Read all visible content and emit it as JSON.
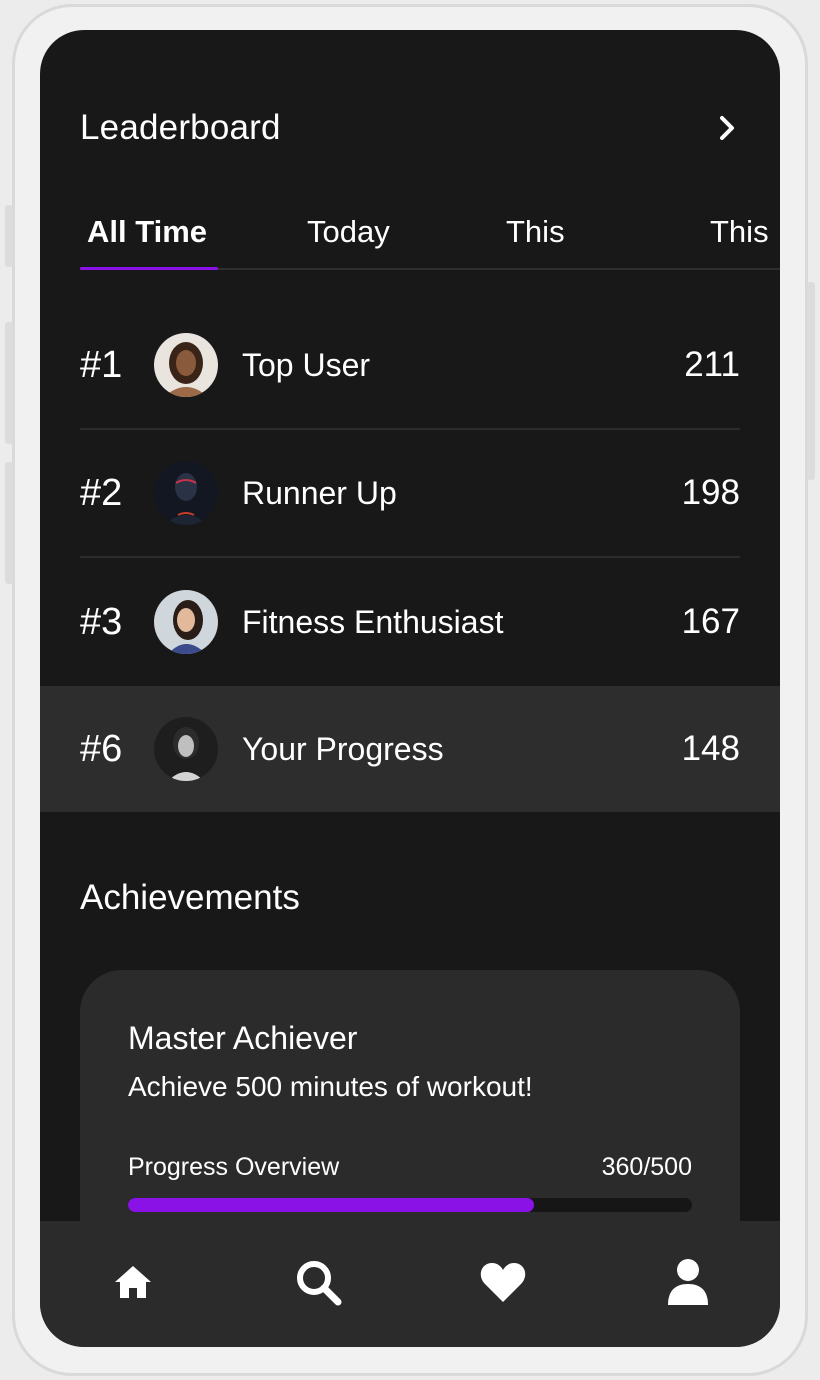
{
  "header": {
    "title": "Leaderboard",
    "chevron_icon": "chevron-right-icon"
  },
  "tabs": [
    {
      "label": "All Time",
      "active": true
    },
    {
      "label": "Today",
      "active": false
    },
    {
      "label": "This",
      "active": false
    },
    {
      "label": "This",
      "active": false
    }
  ],
  "leaderboard": [
    {
      "rank": "#1",
      "name": "Top User",
      "score": "211"
    },
    {
      "rank": "#2",
      "name": "Runner Up",
      "score": "198"
    },
    {
      "rank": "#3",
      "name": "Fitness Enthusiast",
      "score": "167"
    }
  ],
  "current_user": {
    "rank": "#6",
    "name": "Your Progress",
    "score": "148"
  },
  "achievements": {
    "section_title": "Achievements",
    "card": {
      "title": "Master Achiever",
      "description": "Achieve 500 minutes of workout!",
      "progress_label": "Progress Overview",
      "progress_text": "360/500",
      "progress_fraction": 0.72
    }
  },
  "bottom_nav": [
    {
      "icon": "home-icon"
    },
    {
      "icon": "search-icon"
    },
    {
      "icon": "heart-icon"
    },
    {
      "icon": "profile-icon"
    }
  ],
  "colors": {
    "accent": "#8a12e6",
    "background": "#181818",
    "surface": "#2b2b2b"
  }
}
